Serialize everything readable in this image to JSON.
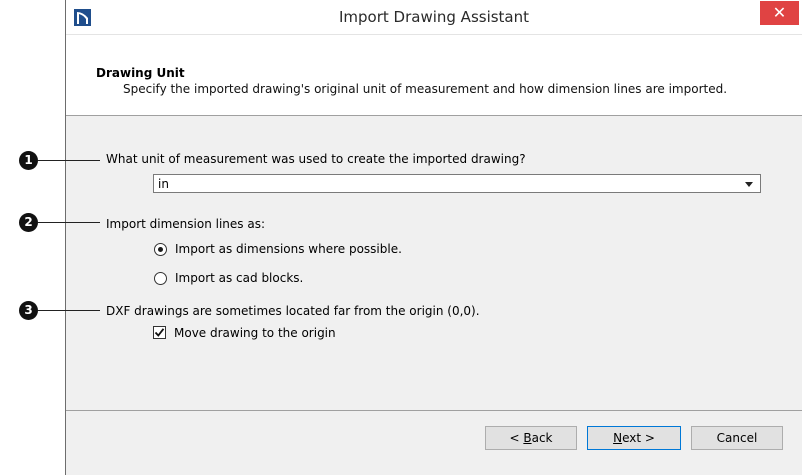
{
  "window": {
    "title": "Import Drawing Assistant",
    "close_glyph": "✕"
  },
  "header": {
    "title": "Drawing Unit",
    "description": "Specify the imported drawing's original unit of measurement and how dimension lines are imported."
  },
  "unit": {
    "question": "What unit of measurement was used to create the imported drawing?",
    "selected": "in"
  },
  "dimension_lines": {
    "question": "Import dimension lines as:",
    "options": [
      {
        "label": "Import as dimensions where possible.",
        "selected": true
      },
      {
        "label": "Import as cad blocks.",
        "selected": false
      }
    ]
  },
  "origin": {
    "note": "DXF drawings are sometimes located far from the origin (0,0).",
    "checkbox_label": "Move drawing to the origin",
    "checked": true
  },
  "buttons": {
    "back_prefix": "< ",
    "back_mnemonic": "B",
    "back_rest": "ack",
    "next_mnemonic": "N",
    "next_rest": "ext >",
    "cancel": "Cancel"
  },
  "callouts": [
    "1",
    "2",
    "3"
  ]
}
